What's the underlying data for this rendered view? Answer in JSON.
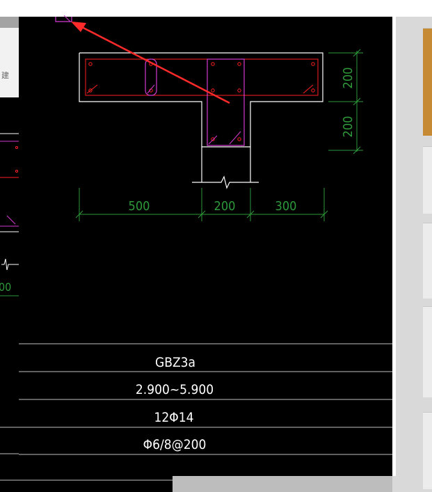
{
  "viewport": {
    "width": 621,
    "height": 707
  },
  "colors": {
    "canvas_bg": "#000000",
    "outline": "#ffffff",
    "rebar": "#ff2020",
    "stirrup": "#d23ad2",
    "dimension": "#2e9a3a",
    "table_text": "#ffffff",
    "annotation_arrow": "#ff2a2a"
  },
  "background_ui": {
    "left_panel_char": "建"
  },
  "drawing": {
    "dimensions": {
      "horizontal": [
        "500",
        "200",
        "300"
      ],
      "vertical": [
        "200",
        "200"
      ]
    },
    "partial_left_dim": "00"
  },
  "table": {
    "rows": [
      {
        "label": "GBZ3a"
      },
      {
        "label": "2.900~5.900"
      },
      {
        "label": "12Φ14"
      },
      {
        "label": "Φ6/8@200"
      }
    ]
  },
  "annotation": {
    "icon": "red-arrow-icon"
  }
}
